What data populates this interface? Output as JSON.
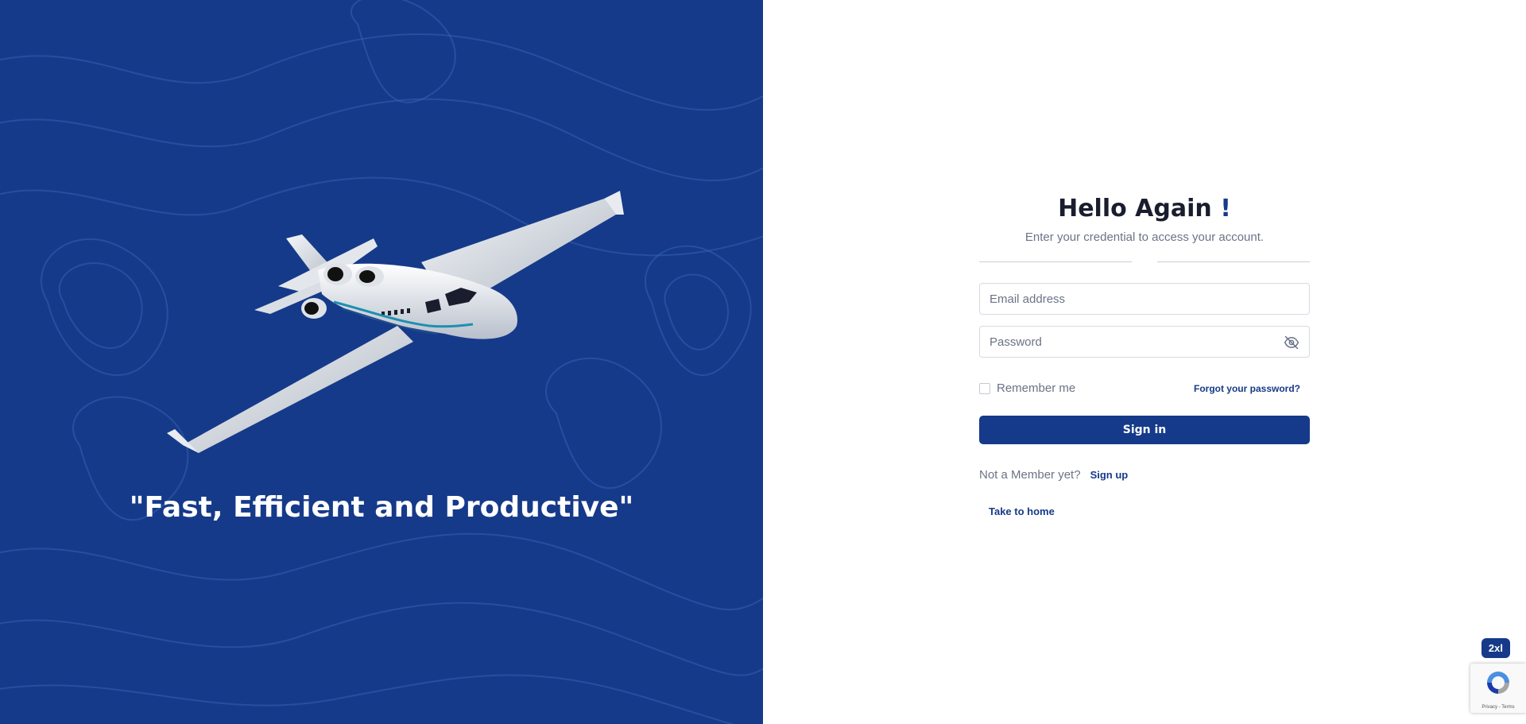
{
  "hero": {
    "tagline": "\"Fast, Efficient and Productive\"",
    "background_color": "#163a8a",
    "image_icon": "private-jet-illustration"
  },
  "form": {
    "title": "Hello Again",
    "title_suffix": "!",
    "subtitle": "Enter your credential to access your account.",
    "email_placeholder": "Email address",
    "email_value": "",
    "password_placeholder": "Password",
    "password_value": "",
    "password_toggle_icon": "eye-off-icon",
    "remember_label": "Remember me",
    "remember_checked": false,
    "forgot_label": "Forgot your password?",
    "signin_label": "Sign in",
    "member_question": "Not a Member yet?",
    "signup_label": "Sign up",
    "home_label": "Take to home"
  },
  "overlay": {
    "breakpoint_badge": "2xl",
    "recaptcha_terms": "Privacy - Terms"
  },
  "colors": {
    "primary": "#163a8a",
    "text_dark": "#1a1d2e",
    "text_muted": "#6b7386",
    "border": "#d6dae2"
  }
}
